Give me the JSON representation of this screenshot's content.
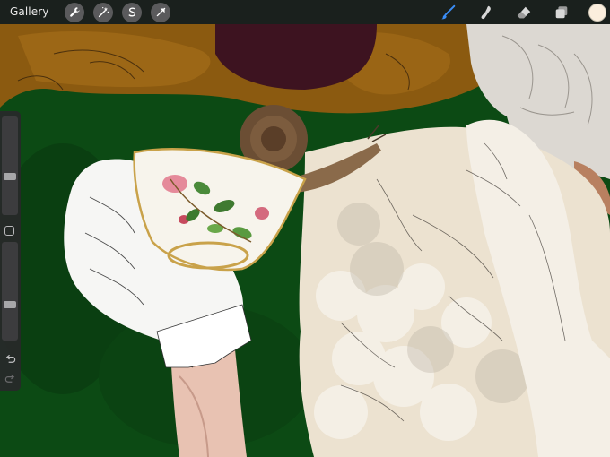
{
  "toolbar": {
    "gallery_label": "Gallery",
    "left_tools": [
      {
        "icon": "wrench-icon",
        "name": "actions"
      },
      {
        "icon": "magic-wand-icon",
        "name": "adjustments"
      },
      {
        "icon": "selection-s-icon",
        "name": "selection"
      },
      {
        "icon": "arrow-cursor-icon",
        "name": "transform"
      }
    ],
    "right_tools": [
      {
        "icon": "brush-icon",
        "name": "paint",
        "active": true
      },
      {
        "icon": "smudge-icon",
        "name": "smudge"
      },
      {
        "icon": "eraser-icon",
        "name": "eraser"
      },
      {
        "icon": "layers-icon",
        "name": "layers"
      }
    ],
    "current_color": "#fbeedd",
    "active_tool_color": "#3a8df6"
  },
  "sidebar": {
    "brush_size_level": 0.38,
    "opacity_level": 0.35
  },
  "colors": {
    "background_green": "#0c4a14",
    "chair_gold": "#8b5a10",
    "chair_inner": "#3d1320",
    "dress_cream": "#ece2d0",
    "glove_white": "#f6f6f4"
  }
}
